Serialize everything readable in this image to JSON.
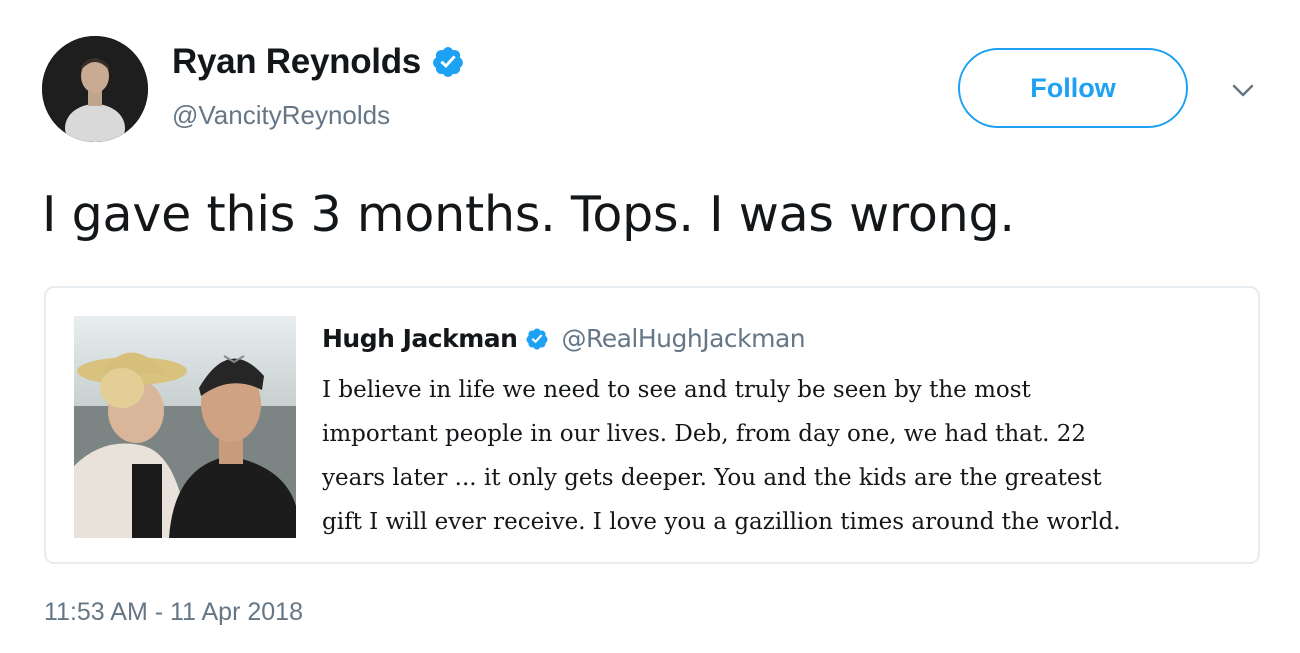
{
  "author": {
    "display_name": "Ryan Reynolds",
    "handle": "@VancityReynolds",
    "verified": true
  },
  "follow_button": {
    "label": "Follow"
  },
  "tweet": {
    "text": "I gave this 3 months. Tops. I was wrong.",
    "timestamp": "11:53 AM - 11 Apr 2018"
  },
  "quoted_tweet": {
    "display_name": "Hugh Jackman",
    "handle": "@RealHughJackman",
    "verified": true,
    "text_lines": [
      "I believe in life we need to see and truly be seen by the most",
      "important people in our lives. Deb, from day one, we had that. 22",
      "years later ... it only gets deeper. You and the kids are the greatest",
      "gift I will ever receive. I love you a gazillion times around the world."
    ]
  },
  "colors": {
    "accent": "#1da1f2",
    "text": "#14171a",
    "secondary_text": "#657786",
    "border": "#e6ecf0"
  },
  "icons": {
    "verified": "verified-badge-icon",
    "menu": "chevron-down-icon"
  }
}
